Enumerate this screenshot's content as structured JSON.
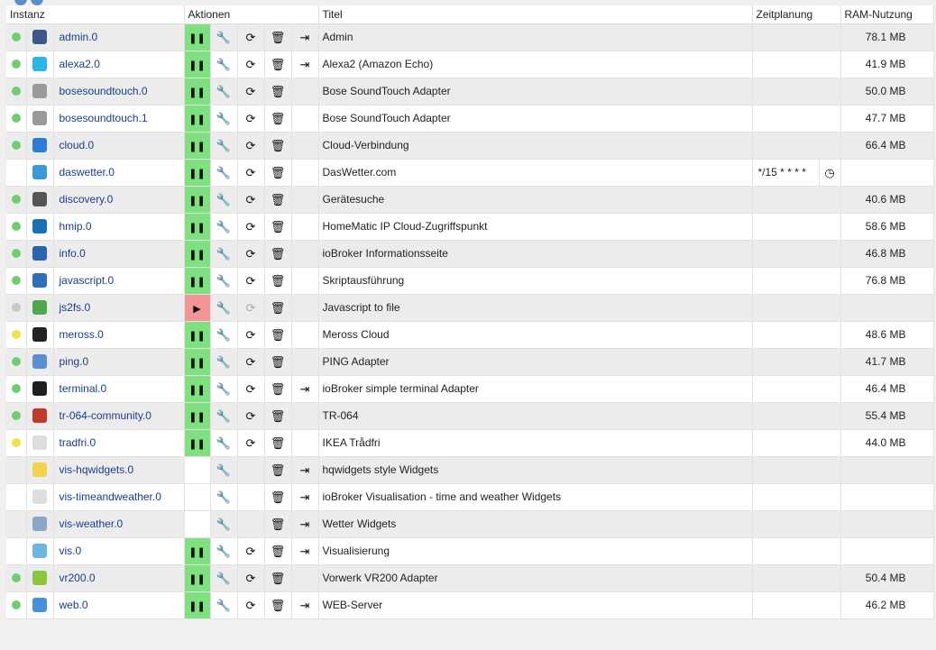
{
  "columns": {
    "instance": "Instanz",
    "actions": "Aktionen",
    "title": "Titel",
    "schedule": "Zeitplanung",
    "ram": "RAM-Nutzung"
  },
  "colors": {
    "running": "#7fe07f",
    "stopped": "#f29595",
    "status_green": "#6fcf6f",
    "status_yellow": "#f2e34a",
    "status_grey": "#c8c8c8",
    "instance_link": "#1a3d8f"
  },
  "icons": {
    "pause": "pause-icon",
    "play": "play-icon",
    "settings": "wrench-icon",
    "restart": "reload-icon",
    "delete": "trash-icon",
    "open": "open-link-icon",
    "schedule": "clock-icon"
  },
  "rows": [
    {
      "instance": "admin.0",
      "status": "green",
      "logo": "#3b5a8a",
      "run": "on",
      "restart": true,
      "link": true,
      "title": "Admin",
      "schedule": "",
      "ram": "78.1 MB"
    },
    {
      "instance": "alexa2.0",
      "status": "green",
      "logo": "#29b6e8",
      "run": "on",
      "restart": true,
      "link": true,
      "title": "Alexa2 (Amazon Echo)",
      "schedule": "",
      "ram": "41.9 MB"
    },
    {
      "instance": "bosesoundtouch.0",
      "status": "green",
      "logo": "#9a9a9a",
      "run": "on",
      "restart": true,
      "link": false,
      "title": "Bose SoundTouch Adapter",
      "schedule": "",
      "ram": "50.0 MB"
    },
    {
      "instance": "bosesoundtouch.1",
      "status": "green",
      "logo": "#9a9a9a",
      "run": "on",
      "restart": true,
      "link": false,
      "title": "Bose SoundTouch Adapter",
      "schedule": "",
      "ram": "47.7 MB"
    },
    {
      "instance": "cloud.0",
      "status": "green",
      "logo": "#2c7bd6",
      "run": "on",
      "restart": true,
      "link": false,
      "title": "Cloud-Verbindung",
      "schedule": "",
      "ram": "66.4 MB"
    },
    {
      "instance": "daswetter.0",
      "status": "none",
      "logo": "#3a9ad9",
      "run": "on",
      "restart": true,
      "link": false,
      "title": "DasWetter.com",
      "schedule": "*/15 * * * *",
      "ram": ""
    },
    {
      "instance": "discovery.0",
      "status": "green",
      "logo": "#555555",
      "run": "on",
      "restart": true,
      "link": false,
      "title": "Gerätesuche",
      "schedule": "",
      "ram": "40.6 MB"
    },
    {
      "instance": "hmip.0",
      "status": "green",
      "logo": "#1b6fb5",
      "run": "on",
      "restart": true,
      "link": false,
      "title": "HomeMatic IP Cloud-Zugriffspunkt",
      "schedule": "",
      "ram": "58.6 MB"
    },
    {
      "instance": "info.0",
      "status": "green",
      "logo": "#2a63b0",
      "run": "on",
      "restart": true,
      "link": false,
      "title": "ioBroker Informationsseite",
      "schedule": "",
      "ram": "46.8 MB"
    },
    {
      "instance": "javascript.0",
      "status": "green",
      "logo": "#2f6fb8",
      "run": "on",
      "restart": true,
      "link": false,
      "title": "Skriptausführung",
      "schedule": "",
      "ram": "76.8 MB"
    },
    {
      "instance": "js2fs.0",
      "status": "grey",
      "logo": "#4caa4c",
      "run": "off",
      "restart": false,
      "link": false,
      "title": "Javascript to file",
      "schedule": "",
      "ram": ""
    },
    {
      "instance": "meross.0",
      "status": "yellow",
      "logo": "#222222",
      "run": "on",
      "restart": true,
      "link": false,
      "title": "Meross Cloud",
      "schedule": "",
      "ram": "48.6 MB"
    },
    {
      "instance": "ping.0",
      "status": "green",
      "logo": "#5b8ed6",
      "run": "on",
      "restart": true,
      "link": false,
      "title": "PING Adapter",
      "schedule": "",
      "ram": "41.7 MB"
    },
    {
      "instance": "terminal.0",
      "status": "green",
      "logo": "#1e1e1e",
      "run": "on",
      "restart": true,
      "link": true,
      "title": "ioBroker simple terminal Adapter",
      "schedule": "",
      "ram": "46.4 MB"
    },
    {
      "instance": "tr-064-community.0",
      "status": "green",
      "logo": "#c0392b",
      "run": "on",
      "restart": true,
      "link": false,
      "title": "TR-064",
      "schedule": "",
      "ram": "55.4 MB"
    },
    {
      "instance": "tradfri.0",
      "status": "yellow",
      "logo": "#dddddd",
      "run": "on",
      "restart": true,
      "link": false,
      "title": "IKEA Trådfri",
      "schedule": "",
      "ram": "44.0 MB"
    },
    {
      "instance": "vis-hqwidgets.0",
      "status": "none",
      "logo": "#f3d24c",
      "run": "none",
      "restart": false,
      "link": true,
      "title": "hqwidgets style Widgets",
      "schedule": "",
      "ram": ""
    },
    {
      "instance": "vis-timeandweather.0",
      "status": "none",
      "logo": "#dedede",
      "run": "none",
      "restart": false,
      "link": true,
      "title": "ioBroker Visualisation - time and weather Widgets",
      "schedule": "",
      "ram": ""
    },
    {
      "instance": "vis-weather.0",
      "status": "none",
      "logo": "#8aa6c8",
      "run": "none",
      "restart": false,
      "link": true,
      "title": "Wetter Widgets",
      "schedule": "",
      "ram": ""
    },
    {
      "instance": "vis.0",
      "status": "none",
      "logo": "#6fb5e0",
      "run": "on",
      "restart": true,
      "link": true,
      "title": "Visualisierung",
      "schedule": "",
      "ram": ""
    },
    {
      "instance": "vr200.0",
      "status": "green",
      "logo": "#8cc63f",
      "run": "on",
      "restart": true,
      "link": false,
      "title": "Vorwerk VR200 Adapter",
      "schedule": "",
      "ram": "50.4 MB"
    },
    {
      "instance": "web.0",
      "status": "green",
      "logo": "#4a90d9",
      "run": "on",
      "restart": true,
      "link": true,
      "title": "WEB-Server",
      "schedule": "",
      "ram": "46.2 MB"
    }
  ]
}
